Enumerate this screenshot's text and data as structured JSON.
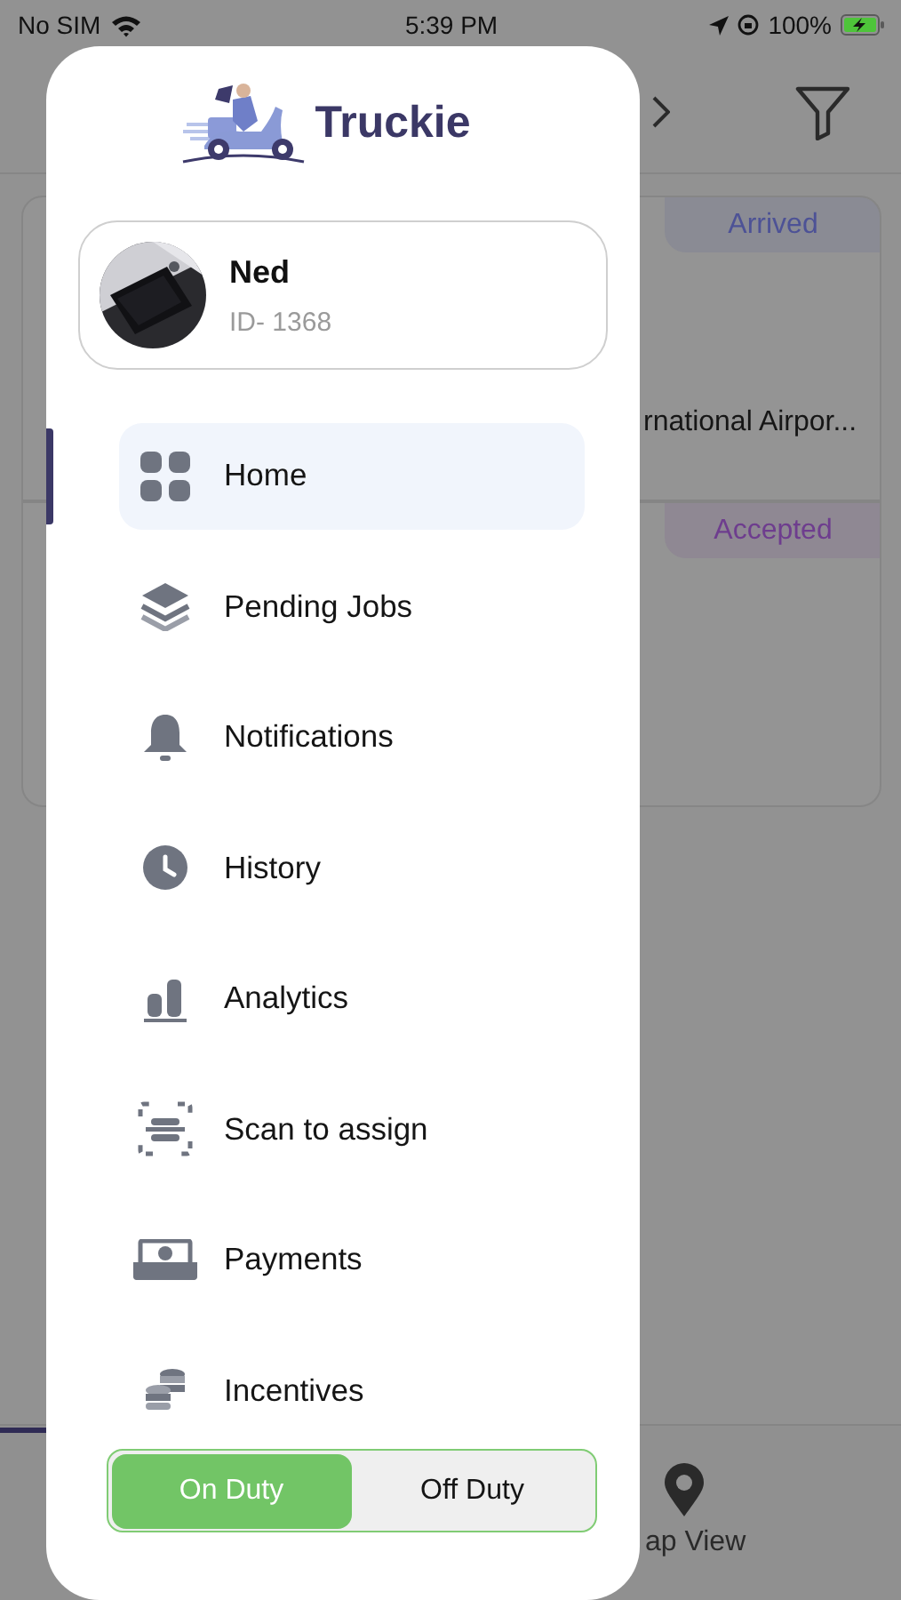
{
  "status_bar": {
    "carrier": "No SIM",
    "time": "5:39 PM",
    "battery": "100%"
  },
  "background": {
    "cards": [
      {
        "status": "Arrived",
        "color": "#4d5296",
        "address": "rnational Airpor..."
      },
      {
        "status": "Accepted",
        "color": "#6e3d8e"
      }
    ],
    "tab_bar": {
      "label": "ap View"
    }
  },
  "drawer": {
    "logo": "Truckie",
    "profile": {
      "name": "Ned",
      "id": "ID- 1368"
    },
    "menu": [
      {
        "label": "Home",
        "selected": true
      },
      {
        "label": "Pending Jobs",
        "selected": false
      },
      {
        "label": "Notifications",
        "selected": false
      },
      {
        "label": "History",
        "selected": false
      },
      {
        "label": "Analytics",
        "selected": false
      },
      {
        "label": "Scan to assign",
        "selected": false
      },
      {
        "label": "Payments",
        "selected": false
      },
      {
        "label": "Incentives",
        "selected": false
      }
    ],
    "duty_toggle": [
      {
        "label": "On Duty",
        "selected": true
      },
      {
        "label": "Off Duty",
        "selected": false
      }
    ]
  }
}
